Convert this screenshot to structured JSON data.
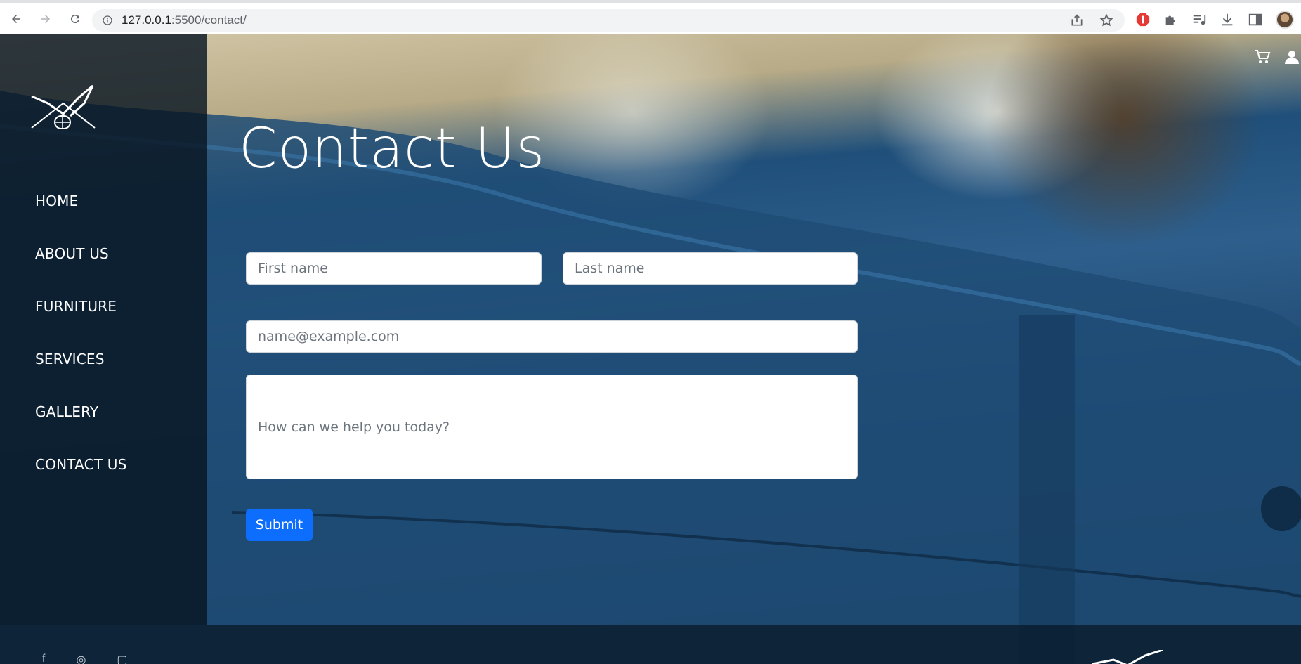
{
  "browser": {
    "url_host": "127.0.0.1",
    "url_rest": ":5500/contact/"
  },
  "nav": {
    "items": [
      {
        "label": "HOME"
      },
      {
        "label": "ABOUT US"
      },
      {
        "label": "FURNITURE"
      },
      {
        "label": "SERVICES"
      },
      {
        "label": "GALLERY"
      },
      {
        "label": "CONTACT US"
      }
    ]
  },
  "page": {
    "title": "Contact Us"
  },
  "form": {
    "first_name_placeholder": "First name",
    "last_name_placeholder": "Last name",
    "email_placeholder": "name@example.com",
    "message_placeholder": "How can we help you today?",
    "submit_label": "Submit"
  },
  "icons": {
    "cart": "cart-icon",
    "user": "user-icon"
  },
  "colors": {
    "primary_button": "#0d6efd",
    "sidebar_bg": "#09162299"
  }
}
